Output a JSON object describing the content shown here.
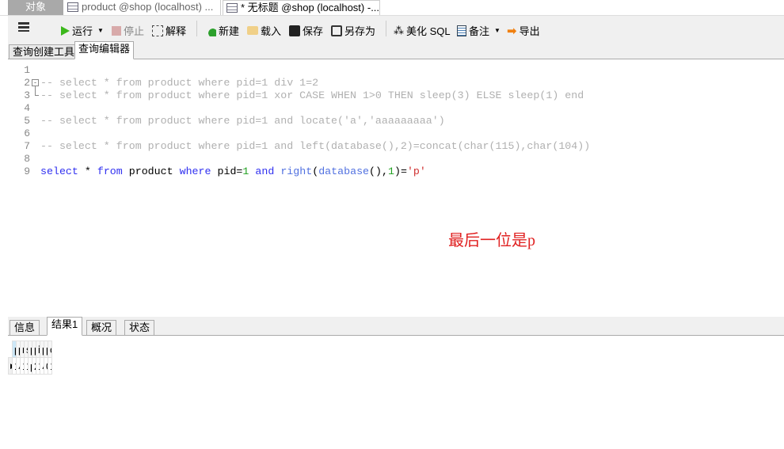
{
  "tabs": [
    {
      "label": "对象"
    },
    {
      "label": "product @shop (localhost) ..."
    },
    {
      "label": "* 无标题 @shop (localhost) -..."
    }
  ],
  "toolbar": {
    "run": "运行",
    "stop": "停止",
    "explain": "解释",
    "new": "新建",
    "load": "载入",
    "save": "保存",
    "save_as": "另存为",
    "beautify": "美化 SQL",
    "comment": "备注",
    "export": "导出"
  },
  "subtabs": [
    {
      "label": "查询创建工具"
    },
    {
      "label": "查询编辑器"
    }
  ],
  "editor": {
    "line_numbers": [
      "1",
      "2",
      "3",
      "4",
      "5",
      "6",
      "7",
      "8",
      "9"
    ],
    "lines": [
      "",
      "-- select * from product where pid=1 div 1=2",
      "-- select * from product where pid=1 xor CASE WHEN 1>0 THEN sleep(3) ELSE sleep(1) end",
      "",
      "-- select * from product where pid=1 and locate('a','aaaaaaaaa')",
      "",
      "-- select * from product where pid=1 and left(database(),2)=concat(char(115),char(104))",
      ""
    ],
    "query": {
      "t1": "select",
      "t2": " * ",
      "t3": "from",
      "t4": " product ",
      "t5": "where",
      "t6": " pid=",
      "t7": "1",
      "t8": " ",
      "t9": "and",
      "t10": " ",
      "t11": "right",
      "t12": "(",
      "t13": "database",
      "t14": "(),",
      "t15": "1",
      "t16": ")=",
      "t17": "'p'"
    }
  },
  "annotation": "最后一位是p",
  "result_tabs": [
    {
      "label": "信息"
    },
    {
      "label": "结果1"
    },
    {
      "label": "概况"
    },
    {
      "label": "状态"
    }
  ],
  "table": {
    "columns": [
      "pid",
      "pname",
      "market_price",
      "shop_price",
      "pimage",
      "pdate",
      "is_hot",
      "pdesc",
      "pflag",
      "cid"
    ],
    "rows": [
      [
        "1",
        "小米 4c 标准",
        "1399",
        "1299",
        "products/1/c",
        "2015-11-02",
        "1",
        "小米 4c 标准",
        "0",
        "1"
      ]
    ]
  }
}
